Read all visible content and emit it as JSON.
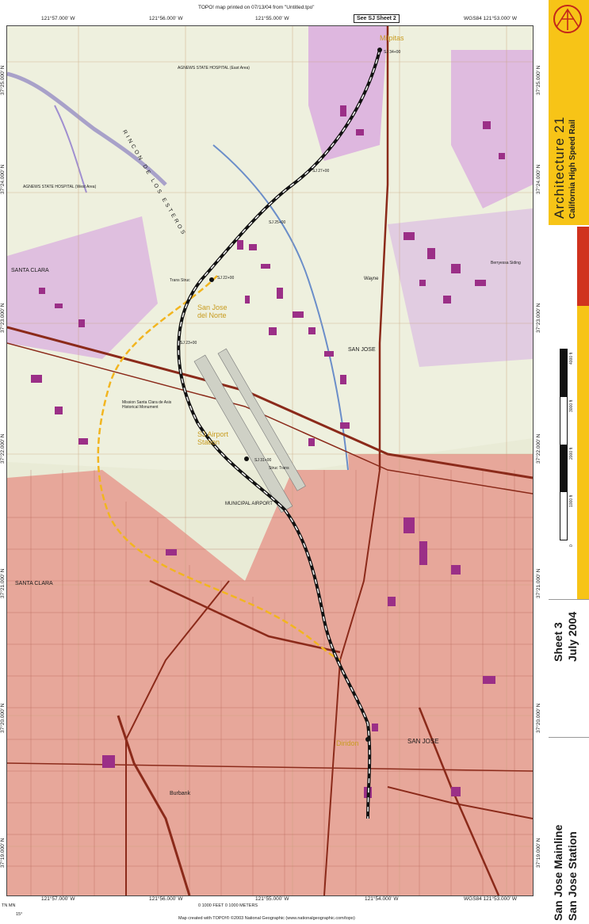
{
  "header": {
    "topo_print_line": "TOPO! map printed on 07/13/04 from \"Untitled.tpo\"",
    "sheet_link": "See SJ Sheet 2"
  },
  "coords": {
    "top": [
      "121°57.000' W",
      "121°56.000' W",
      "121°55.000' W",
      "WGS84 121°53.000' W"
    ],
    "bottom": [
      "121°57.000' W",
      "121°56.000' W",
      "121°55.000' W",
      "121°54.000' W",
      "WGS84 121°53.000' W"
    ],
    "left": [
      "37°25.000' N",
      "37°24.000' N",
      "37°23.000' N",
      "37°22.000' N",
      "37°21.000' N",
      "37°20.000' N",
      "37°19.000' N"
    ],
    "right": [
      "37°25.000' N",
      "37°24.000' N",
      "37°23.000' N",
      "37°22.000' N",
      "37°21.000' N",
      "37°20.000' N",
      "37°19.000' N"
    ]
  },
  "map_labels": {
    "milpitas": "Milpitas",
    "sj_de_norte": "San Jose del Norte",
    "sj_airport": "SJ Airport Station",
    "diridon": "Diridon",
    "santa_clara_top": "SANTA CLARA",
    "santa_clara_mid": "SANTA CLARA",
    "san_jose_mid": "SAN JOSE",
    "san_jose_low": "SAN JOSE",
    "municipal_airport": "MUNICIPAL AIRPORT",
    "rincon": "RINCON DE LOS ESTEROS",
    "agnews_east": "AGNEWS STATE HOSPITAL (East Area)",
    "agnews_west": "AGNEWS STATE HOSPITAL (West Area)",
    "mission": "Mission Santa Clara de Asis Historical Monument",
    "burbank": "Burbank",
    "wayne": "Wayne",
    "berryessa": "Berryessa Siding",
    "stations": [
      "SJ 22+00",
      "SJ 23+00",
      "SJ 25+00",
      "SJ 27+00",
      "SJ 31+00",
      "SJ 34+00",
      "Trans Struc",
      "Struc Trans"
    ]
  },
  "branding": {
    "title": "Architecture 21",
    "subtitle": "California High Speed Rail",
    "scale_ticks": [
      "0",
      "1000 ft",
      "2000 ft",
      "3000 ft",
      "4000 ft"
    ]
  },
  "sheet": {
    "number": "Sheet 3",
    "date": "July 2004"
  },
  "title_block": {
    "line1": "San Jose Mainline",
    "line2": "San Jose Station"
  },
  "footer": {
    "north": "TN MN",
    "declination": "15°",
    "scale_ft": "0   1000 FEET   0   1000 METERS",
    "credit": "Map created with TOPO!® ©2003 National Geographic (www.nationalgeographic.com/topo)"
  },
  "colors": {
    "urban_tint": "#e7a79a",
    "building": "#9b2f87",
    "park": "#cfa6dc",
    "route": "#111111",
    "alt_route": "#f2b51f",
    "map_bg": "#e9ebd6",
    "brand_yellow": "#f7c417",
    "brand_red": "#d0321e"
  }
}
